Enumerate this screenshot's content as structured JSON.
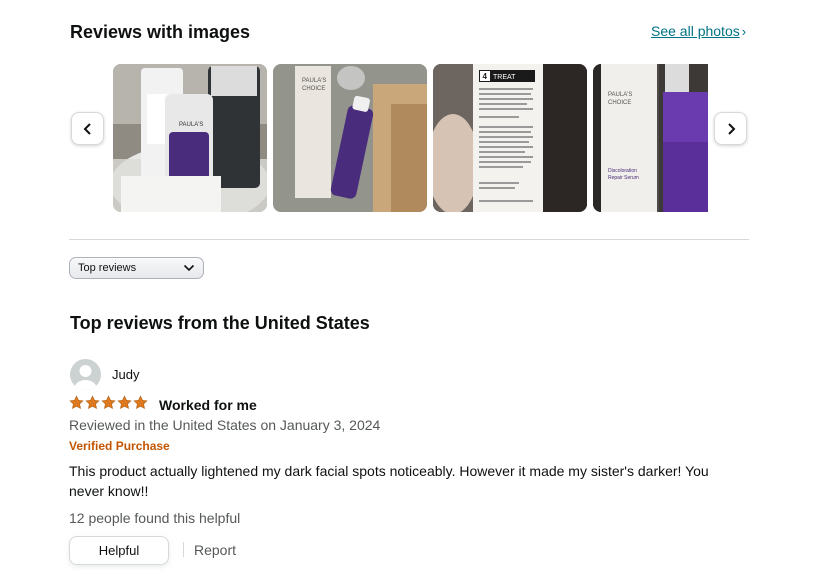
{
  "images_section": {
    "title": "Reviews with images",
    "see_all_label": "See all photos",
    "see_all_chevron": "›",
    "prev_icon": "chevron-left-icon",
    "next_icon": "chevron-right-icon",
    "thumbnails": [
      {
        "brand_text_1": "PAULA'S",
        "brand_text_2": "CHOICE"
      },
      {
        "brand_text_1": "PAULA'S",
        "brand_text_2": "CHOICE"
      },
      {
        "step_number": "4",
        "step_label": "TREAT"
      },
      {
        "brand_text_1": "PAULA'S",
        "brand_text_2": "CHOICE",
        "product_line_1": "Discoloration",
        "product_line_2": "Repair Serum"
      }
    ]
  },
  "sort": {
    "selected": "Top reviews",
    "icon": "chevron-down-icon"
  },
  "reviews_section": {
    "title": "Top reviews from the United States"
  },
  "review": {
    "author": "Judy",
    "rating": 5,
    "rating_max": 5,
    "title": "Worked for me",
    "date": "Reviewed in the United States on January 3, 2024",
    "verified": "Verified Purchase",
    "body": "This product actually lightened my dark facial spots noticeably. However it made my sister's darker! You never know!!",
    "helpful_count": "12 people found this helpful",
    "helpful_label": "Helpful",
    "report_label": "Report"
  },
  "colors": {
    "link": "#007185",
    "star": "#de7921",
    "verified": "#c45500",
    "muted": "#565959",
    "border": "#d5d9d9"
  }
}
